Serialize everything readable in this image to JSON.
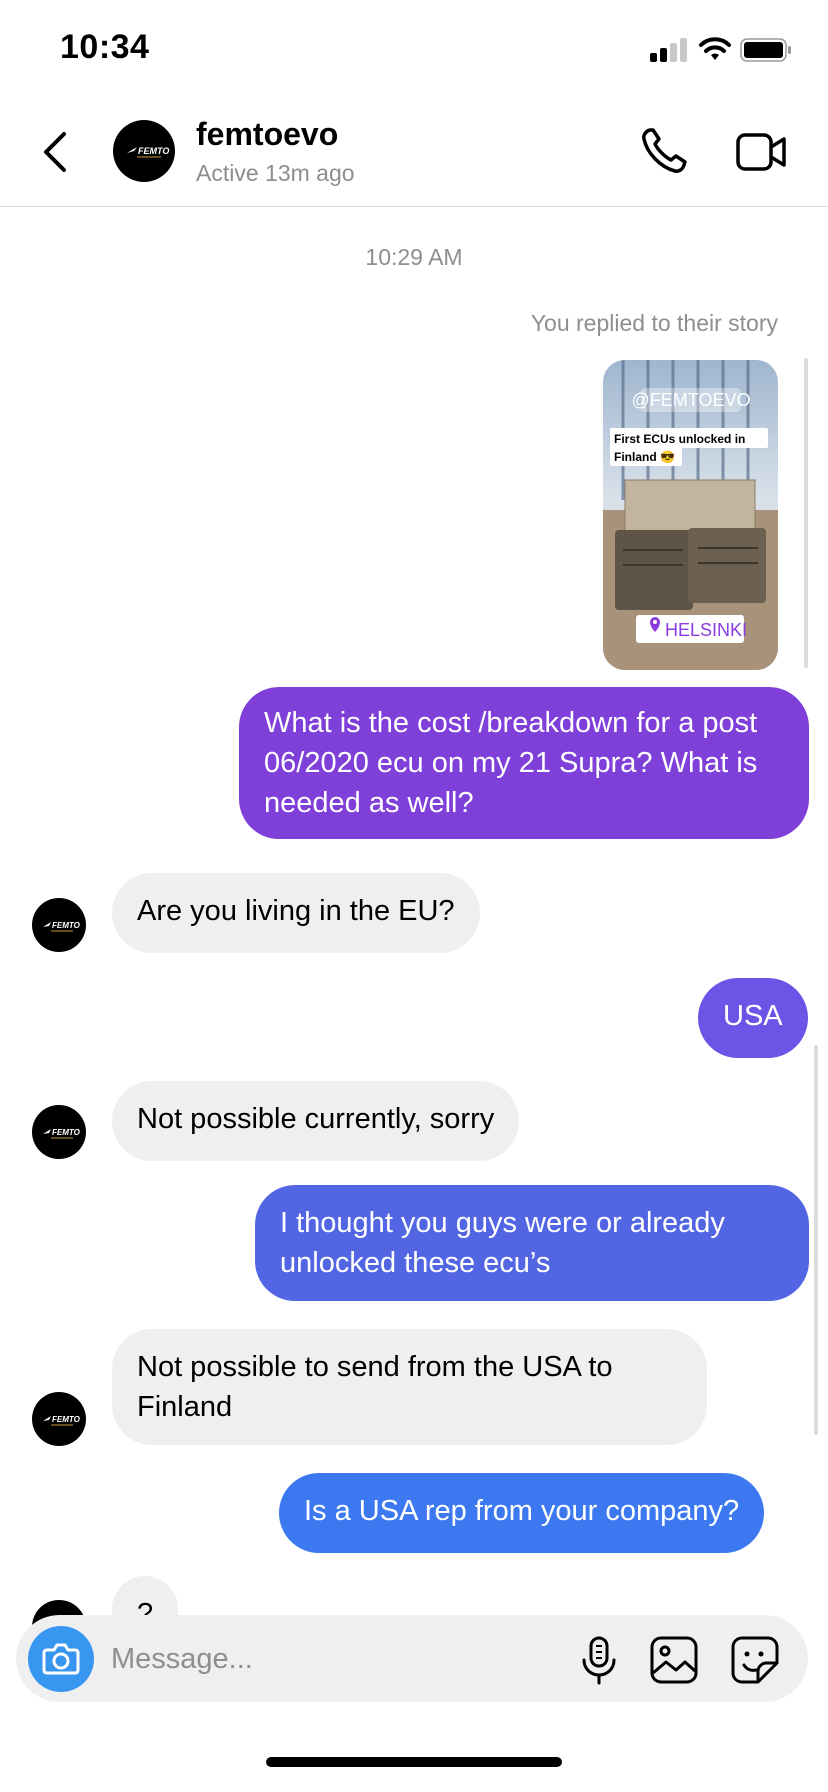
{
  "status_bar": {
    "time": "10:34"
  },
  "header": {
    "contact_name": "femtoevo",
    "contact_status": "Active 13m ago",
    "avatar_logo_text": "FEMTO"
  },
  "chat": {
    "timestamp": "10:29 AM",
    "story_note": "You replied to their story",
    "story": {
      "handle": "@FEMTOEVO",
      "caption_line1": "First ECUs unlocked in",
      "caption_line2": "Finland 😎",
      "location": "HELSINKI"
    },
    "messages": [
      {
        "from": "me",
        "text": "What is the cost /breakdown for a post 06/2020 ecu on my 21 Supra? What is needed as well?"
      },
      {
        "from": "them",
        "text": "Are you living in the EU?"
      },
      {
        "from": "me",
        "text": "USA"
      },
      {
        "from": "them",
        "text": "Not possible currently, sorry"
      },
      {
        "from": "me",
        "text": "I thought you guys were or already unlocked these ecu’s"
      },
      {
        "from": "them",
        "text": "Not possible to send from the USA to Finland"
      },
      {
        "from": "me",
        "text": "Is a USA rep from your company?"
      },
      {
        "from": "them",
        "text": "?"
      }
    ]
  },
  "composer": {
    "placeholder": "Message..."
  },
  "colors": {
    "bubble_purple": "#7f3fd9",
    "bubble_violet": "#6a55e6",
    "bubble_indigo": "#5266e4",
    "bubble_blue": "#3c79f0",
    "incoming_bg": "#efefef",
    "camera_blue": "#3797f0"
  }
}
